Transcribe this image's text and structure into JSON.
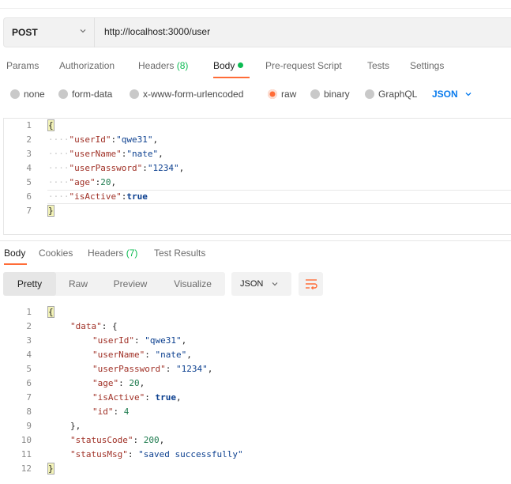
{
  "request": {
    "method": "POST",
    "url": "http://localhost:3000/user"
  },
  "request_tabs": {
    "params": "Params",
    "authorization": "Authorization",
    "headers": "Headers",
    "headers_count": "(8)",
    "body": "Body",
    "prerequest": "Pre-request Script",
    "tests": "Tests",
    "settings": "Settings"
  },
  "body_types": {
    "none": "none",
    "form_data": "form-data",
    "urlencoded": "x-www-form-urlencoded",
    "raw": "raw",
    "binary": "binary",
    "graphql": "GraphQL",
    "selected_format": "JSON"
  },
  "request_body": {
    "line_numbers": [
      "1",
      "2",
      "3",
      "4",
      "5",
      "6",
      "7"
    ],
    "open": "{",
    "close": "}",
    "fields": [
      {
        "key": "\"userId\"",
        "sep": ":",
        "value": "\"qwe31\"",
        "tail": ","
      },
      {
        "key": "\"userName\"",
        "sep": ":",
        "value": "\"nate\"",
        "tail": ","
      },
      {
        "key": "\"userPassword\"",
        "sep": ":",
        "value": "\"1234\"",
        "tail": ","
      },
      {
        "key": "\"age\"",
        "sep": ":",
        "value": "20",
        "tail": ","
      },
      {
        "key": "\"isActive\"",
        "sep": ":",
        "value": "true",
        "tail": ""
      }
    ],
    "indent_dots": "····"
  },
  "response_tabs": {
    "body": "Body",
    "cookies": "Cookies",
    "headers": "Headers",
    "headers_count": "(7)",
    "test_results": "Test Results"
  },
  "view_modes": {
    "pretty": "Pretty",
    "raw": "Raw",
    "preview": "Preview",
    "visualize": "Visualize",
    "format": "JSON"
  },
  "response_body": {
    "line_numbers": [
      "1",
      "2",
      "3",
      "4",
      "5",
      "6",
      "7",
      "8",
      "9",
      "10",
      "11",
      "12"
    ],
    "open": "{",
    "close": "}",
    "data_key": "\"data\"",
    "data_open": ": {",
    "data_close": "},",
    "data_fields": [
      {
        "key": "\"userId\"",
        "value": "\"qwe31\"",
        "tail": ","
      },
      {
        "key": "\"userName\"",
        "value": "\"nate\"",
        "tail": ","
      },
      {
        "key": "\"userPassword\"",
        "value": "\"1234\"",
        "tail": ","
      },
      {
        "key": "\"age\"",
        "value": "20",
        "tail": ","
      },
      {
        "key": "\"isActive\"",
        "value": "true",
        "tail": ","
      },
      {
        "key": "\"id\"",
        "value": "4",
        "tail": ""
      }
    ],
    "status_code_key": "\"statusCode\"",
    "status_code_value": "200",
    "status_msg_key": "\"statusMsg\"",
    "status_msg_value": "\"saved successfully\""
  },
  "colors": {
    "accent": "#ff6c37",
    "active_dot": "#0cbb52",
    "link_blue": "#097bed"
  }
}
